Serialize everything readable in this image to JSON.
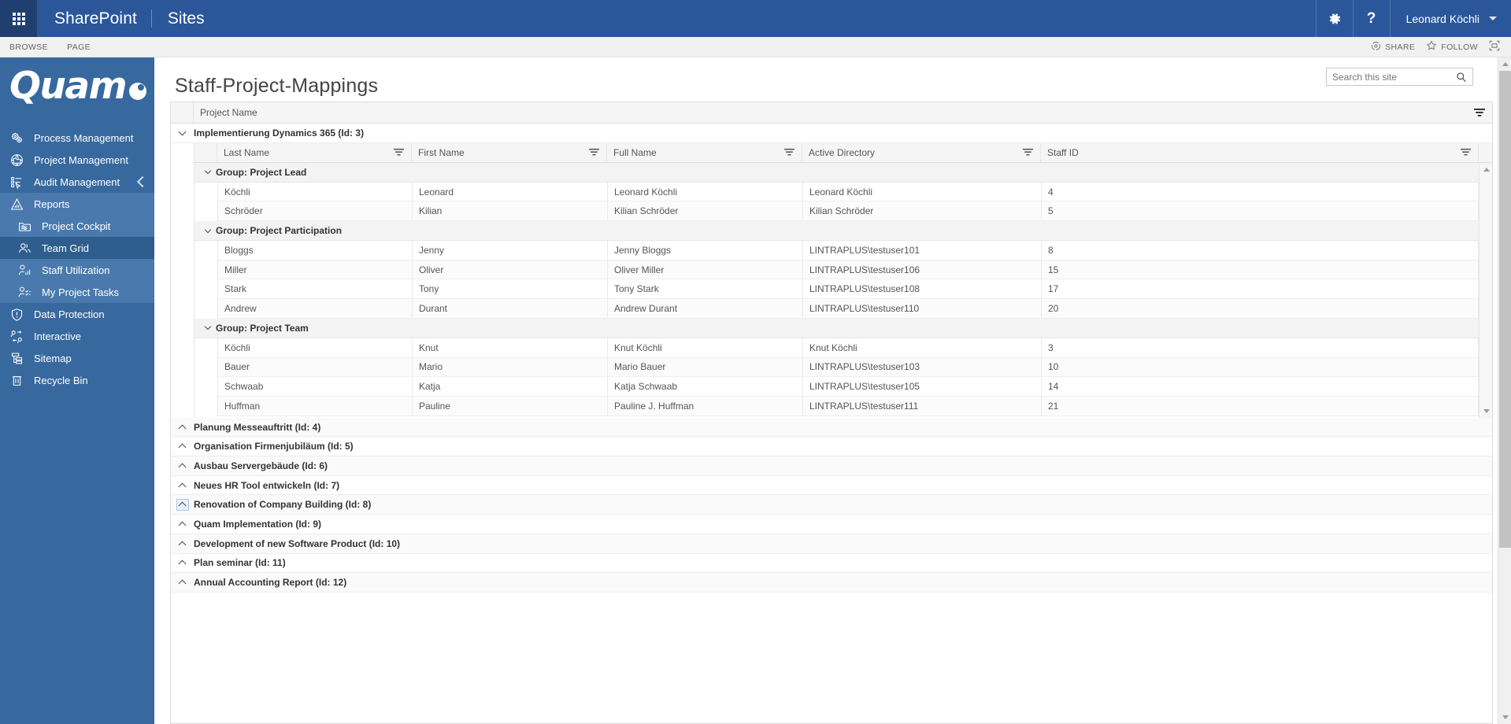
{
  "suite_bar": {
    "waffle_icon": "app-launcher-icon",
    "brand": "SharePoint",
    "sites_label": "Sites",
    "settings_icon": "gear-icon",
    "help_icon": "question-mark-icon",
    "user_name": "Leonard Köchli",
    "user_caret_icon": "chevron-down-icon"
  },
  "ribbon": {
    "tabs": [
      {
        "label": "BROWSE"
      },
      {
        "label": "PAGE"
      }
    ],
    "actions": [
      {
        "label": "SHARE",
        "icon": "share-icon"
      },
      {
        "label": "FOLLOW",
        "icon": "star-icon"
      }
    ],
    "focus_icon": "focus-on-content-icon"
  },
  "left_nav": {
    "logo_text": "Quam",
    "logo_mark_icon": "quam-dot-icon",
    "collapse_icon": "chevron-left-icon",
    "items": [
      {
        "label": "Process Management",
        "icon": "gears-icon",
        "level": 0,
        "state": "normal"
      },
      {
        "label": "Project Management",
        "icon": "globe-folder-icon",
        "level": 0,
        "state": "normal"
      },
      {
        "label": "Audit Management",
        "icon": "checklist-cursor-icon",
        "level": 0,
        "state": "normal"
      },
      {
        "label": "Reports",
        "icon": "bar-chart-triangle-icon",
        "level": 0,
        "state": "group-selected"
      },
      {
        "label": "Project Cockpit",
        "icon": "folder-sliders-icon",
        "level": 1,
        "state": "child"
      },
      {
        "label": "Team Grid",
        "icon": "people-icon",
        "level": 1,
        "state": "child-selected"
      },
      {
        "label": "Staff Utilization",
        "icon": "person-chart-icon",
        "level": 1,
        "state": "child"
      },
      {
        "label": "My Project Tasks",
        "icon": "person-tasks-icon",
        "level": 1,
        "state": "child"
      },
      {
        "label": "Data Protection",
        "icon": "shield-exclamation-icon",
        "level": 0,
        "state": "normal"
      },
      {
        "label": "Interactive",
        "icon": "two-people-arrows-icon",
        "level": 0,
        "state": "normal"
      },
      {
        "label": "Sitemap",
        "icon": "sitemap-icon",
        "level": 0,
        "state": "normal"
      },
      {
        "label": "Recycle Bin",
        "icon": "trash-icon",
        "level": 0,
        "state": "normal"
      }
    ]
  },
  "page": {
    "title": "Staff-Project-Mappings"
  },
  "search": {
    "placeholder": "Search this site",
    "value": "",
    "icon": "magnifier-icon"
  },
  "grid": {
    "outer_header": {
      "label": "Project Name",
      "filter_icon": "filter-icon"
    },
    "expanded_project": {
      "title": "Implementierung Dynamics 365 (Id: 3)",
      "expand_icon": "chevron-down-icon",
      "columns": [
        {
          "label": "Last Name",
          "filter_icon": "filter-icon"
        },
        {
          "label": "First Name",
          "filter_icon": "filter-icon"
        },
        {
          "label": "Full Name",
          "filter_icon": "filter-icon"
        },
        {
          "label": "Active Directory",
          "filter_icon": "filter-icon"
        },
        {
          "label": "Staff ID",
          "filter_icon": "filter-icon"
        }
      ],
      "groups": [
        {
          "title": "Group: Project Lead",
          "expand_icon": "chevron-down-icon",
          "rows": [
            {
              "last_name": "Köchli",
              "first_name": "Leonard",
              "full_name": "Leonard Köchli",
              "active_directory": "Leonard Köchli",
              "staff_id": "4"
            },
            {
              "last_name": "Schröder",
              "first_name": "Kilian",
              "full_name": "Kilian Schröder",
              "active_directory": "Kilian Schröder",
              "staff_id": "5"
            }
          ]
        },
        {
          "title": "Group: Project Participation",
          "expand_icon": "chevron-down-icon",
          "rows": [
            {
              "last_name": "Bloggs",
              "first_name": "Jenny",
              "full_name": "Jenny Bloggs",
              "active_directory": "LINTRAPLUS\\testuser101",
              "staff_id": "8"
            },
            {
              "last_name": "Miller",
              "first_name": "Oliver",
              "full_name": "Oliver Miller",
              "active_directory": "LINTRAPLUS\\testuser106",
              "staff_id": "15"
            },
            {
              "last_name": "Stark",
              "first_name": "Tony",
              "full_name": "Tony Stark",
              "active_directory": "LINTRAPLUS\\testuser108",
              "staff_id": "17"
            },
            {
              "last_name": "Andrew",
              "first_name": "Durant",
              "full_name": "Andrew Durant",
              "active_directory": "LINTRAPLUS\\testuser110",
              "staff_id": "20"
            }
          ]
        },
        {
          "title": "Group: Project Team",
          "expand_icon": "chevron-down-icon",
          "rows": [
            {
              "last_name": "Köchli",
              "first_name": "Knut",
              "full_name": "Knut Köchli",
              "active_directory": "Knut Köchli",
              "staff_id": "3"
            },
            {
              "last_name": "Bauer",
              "first_name": "Mario",
              "full_name": "Mario Bauer",
              "active_directory": "LINTRAPLUS\\testuser103",
              "staff_id": "10"
            },
            {
              "last_name": "Schwaab",
              "first_name": "Katja",
              "full_name": "Katja Schwaab",
              "active_directory": "LINTRAPLUS\\testuser105",
              "staff_id": "14"
            },
            {
              "last_name": "Huffman",
              "first_name": "Pauline",
              "full_name": "Pauline J. Huffman",
              "active_directory": "LINTRAPLUS\\testuser111",
              "staff_id": "21"
            }
          ]
        }
      ]
    },
    "collapsed_projects": [
      {
        "title": "Planung Messeauftritt (Id: 4)",
        "expand_icon": "chevron-up-icon",
        "focused": false
      },
      {
        "title": "Organisation Firmenjubiläum (Id: 5)",
        "expand_icon": "chevron-up-icon",
        "focused": false
      },
      {
        "title": "Ausbau Servergebäude (Id: 6)",
        "expand_icon": "chevron-up-icon",
        "focused": false
      },
      {
        "title": "Neues HR Tool entwickeln (Id: 7)",
        "expand_icon": "chevron-up-icon",
        "focused": false
      },
      {
        "title": "Renovation of Company Building (Id: 8)",
        "expand_icon": "chevron-up-icon",
        "focused": true
      },
      {
        "title": "Quam Implementation (Id: 9)",
        "expand_icon": "chevron-up-icon",
        "focused": false
      },
      {
        "title": "Development of new Software Product (Id: 10)",
        "expand_icon": "chevron-up-icon",
        "focused": false
      },
      {
        "title": "Plan seminar (Id: 11)",
        "expand_icon": "chevron-up-icon",
        "focused": false
      },
      {
        "title": "Annual Accounting Report (Id: 12)",
        "expand_icon": "chevron-up-icon",
        "focused": false
      }
    ],
    "inner_scrollbar": {
      "up_icon": "scroll-up-arrow-icon",
      "down_icon": "scroll-down-arrow-icon"
    },
    "page_scrollbar": {
      "up_icon": "scroll-up-arrow-icon",
      "down_icon": "scroll-down-arrow-icon"
    }
  },
  "colors": {
    "suite_bar": "#2b579a",
    "nav_bg": "#37699e",
    "nav_group_selected": "#4a7aad",
    "nav_selected": "#2f5d8e",
    "accent": "#2b579a"
  }
}
